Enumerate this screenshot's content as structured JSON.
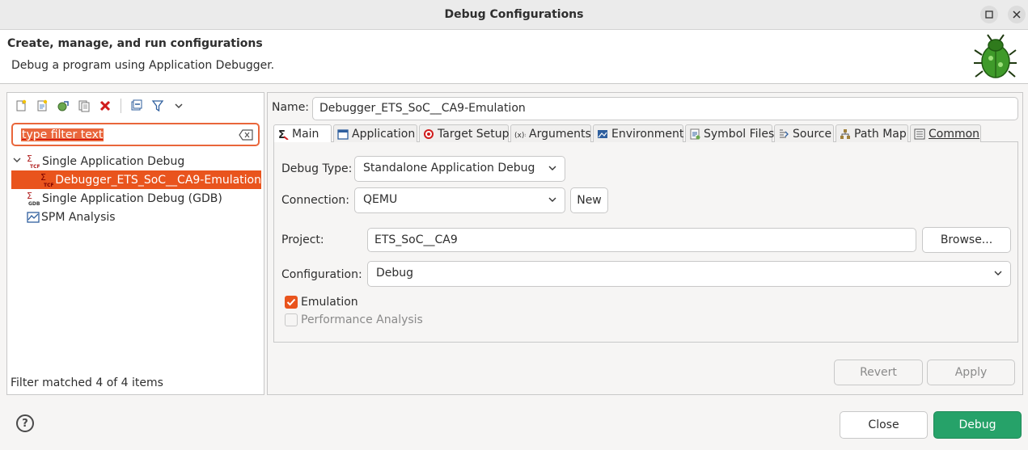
{
  "window": {
    "title": "Debug Configurations"
  },
  "header": {
    "title": "Create, manage, and run configurations",
    "subtitle": "Debug a program using Application Debugger."
  },
  "left": {
    "filter_placeholder": "type filter text",
    "tree": [
      {
        "label": "Single Application Debug",
        "icon": "tcf-icon"
      },
      {
        "label": "Debugger_ETS_SoC__CA9-Emulation",
        "icon": "tcf-icon"
      },
      {
        "label": "Single Application Debug (GDB)",
        "icon": "gdb-icon"
      },
      {
        "label": "SPM Analysis",
        "icon": "chart-icon"
      }
    ],
    "status": "Filter matched 4 of 4 items"
  },
  "main": {
    "name_label": "Name:",
    "name_value": "Debugger_ETS_SoC__CA9-Emulation",
    "tabs": [
      {
        "label": "Main",
        "icon": "main-icon"
      },
      {
        "label": "Application",
        "icon": "window-icon"
      },
      {
        "label": "Target Setup",
        "icon": "target-icon"
      },
      {
        "label": "Arguments",
        "icon": "arguments-icon"
      },
      {
        "label": "Environment",
        "icon": "environment-icon"
      },
      {
        "label": "Symbol Files",
        "icon": "symbol-files-icon"
      },
      {
        "label": "Source",
        "icon": "source-icon"
      },
      {
        "label": "Path Map",
        "icon": "path-map-icon"
      },
      {
        "label": "Common",
        "icon": "common-icon"
      }
    ],
    "debug_type_label": "Debug Type:",
    "debug_type_value": "Standalone Application Debug",
    "connection_label": "Connection:",
    "connection_value": "QEMU",
    "new_label": "New",
    "project_label": "Project:",
    "project_value": "ETS_SoC__CA9",
    "browse_label": "Browse...",
    "configuration_label": "Configuration:",
    "configuration_value": "Debug",
    "emulation_label": "Emulation",
    "emulation_checked": true,
    "performance_label": "Performance Analysis",
    "performance_checked": false,
    "revert_label": "Revert",
    "apply_label": "Apply"
  },
  "footer": {
    "close_label": "Close",
    "debug_label": "Debug"
  },
  "colors": {
    "accent": "#e9541d",
    "primary": "#26a269"
  }
}
